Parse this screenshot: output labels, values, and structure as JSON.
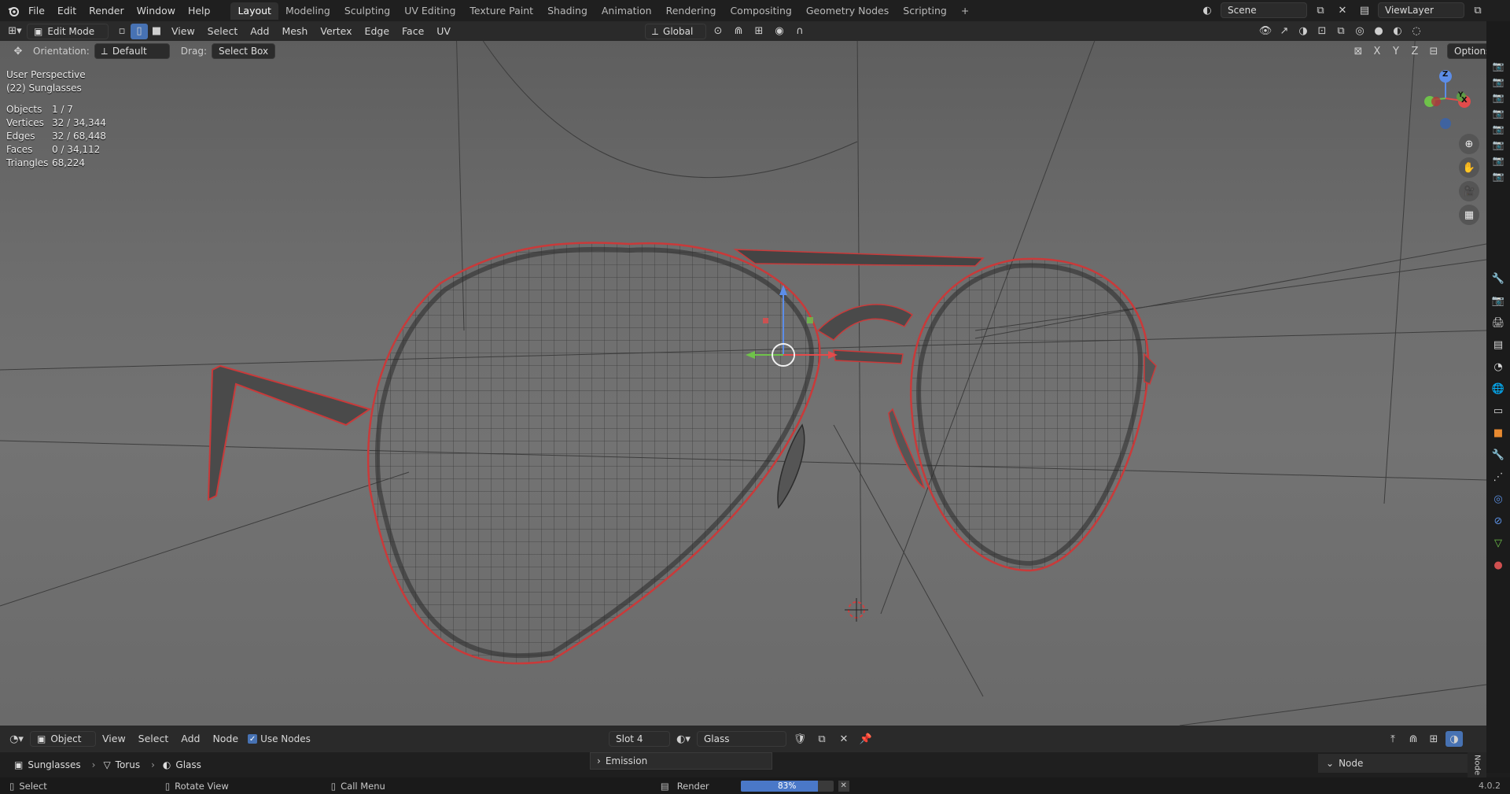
{
  "topbar": {
    "menus": [
      "File",
      "Edit",
      "Render",
      "Window",
      "Help"
    ],
    "workspaces": [
      "Layout",
      "Modeling",
      "Sculpting",
      "UV Editing",
      "Texture Paint",
      "Shading",
      "Animation",
      "Rendering",
      "Compositing",
      "Geometry Nodes",
      "Scripting"
    ],
    "active_workspace": "Layout",
    "add_tab": "+",
    "scene": "Scene",
    "view_layer": "ViewLayer"
  },
  "viewport_header": {
    "mode": "Edit Mode",
    "menus": [
      "View",
      "Select",
      "Add",
      "Mesh",
      "Vertex",
      "Edge",
      "Face",
      "UV"
    ],
    "transform_orientation": "Global",
    "options_label": "Options",
    "axes": [
      "X",
      "Y",
      "Z"
    ]
  },
  "tool_settings": {
    "orientation_label": "Orientation:",
    "orientation_value": "Default",
    "drag_label": "Drag:",
    "drag_value": "Select Box"
  },
  "overlay": {
    "view_name": "User Perspective",
    "object_name": "(22) Sunglasses",
    "stats": [
      {
        "label": "Objects",
        "value": "1 / 7"
      },
      {
        "label": "Vertices",
        "value": "32 / 34,344"
      },
      {
        "label": "Edges",
        "value": "32 / 68,448"
      },
      {
        "label": "Faces",
        "value": "0 / 34,112"
      },
      {
        "label": "Triangles",
        "value": "68,224"
      }
    ]
  },
  "gizmo_axes": {
    "z": "Z",
    "y": "Y",
    "x": "X"
  },
  "node_editor": {
    "object_type": "Object",
    "menus": [
      "View",
      "Select",
      "Add",
      "Node"
    ],
    "use_nodes_label": "Use Nodes",
    "use_nodes_checked": true,
    "slot": "Slot 4",
    "material": "Glass",
    "emission_panel": "Emission",
    "node_tab": "Node",
    "sidebar_tab": "Node"
  },
  "breadcrumb": [
    "Sunglasses",
    "Torus",
    "Glass"
  ],
  "statusbar": {
    "select": "Select",
    "rotate": "Rotate View",
    "call_menu": "Call Menu",
    "render_label": "Render",
    "progress_text": "83%",
    "progress_value": 0.83,
    "version": "4.0.2"
  },
  "colors": {
    "accent": "#4772b3",
    "selected_edge": "#d04040",
    "header": "#2a2a2a"
  }
}
